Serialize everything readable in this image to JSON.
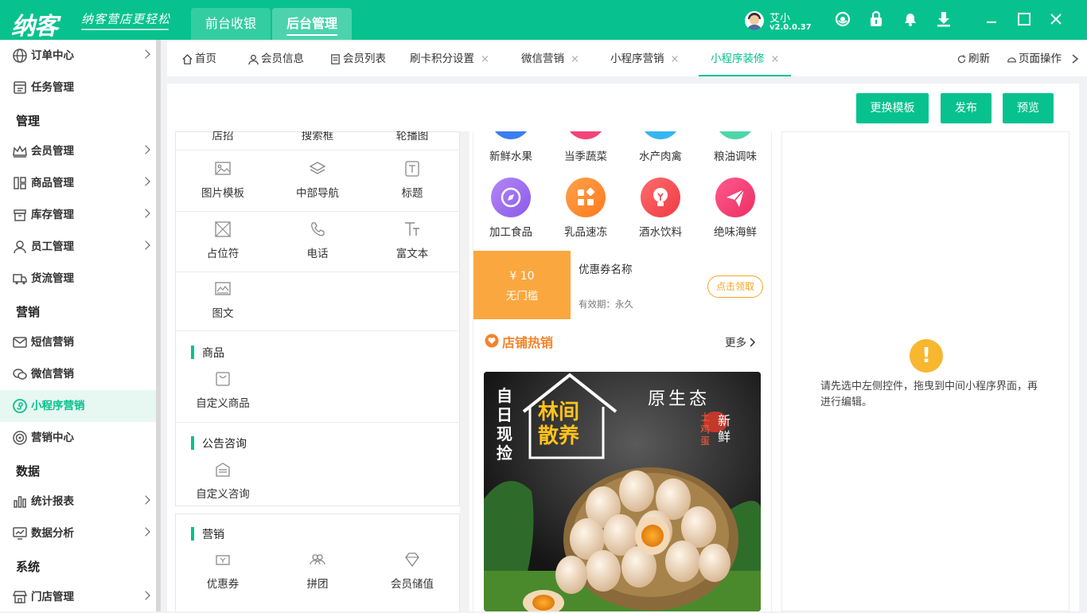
{
  "topbar": {
    "logo": "纳客",
    "slogan": "纳客营店更轻松",
    "nav": [
      "前台收银",
      "后台管理"
    ],
    "user_name": "艾小",
    "version": "v2.0.0.37"
  },
  "sidebar": {
    "items": [
      {
        "label": "订单中心",
        "arrow": true
      },
      {
        "label": "任务管理",
        "arrow": false
      }
    ],
    "section_manage": "管理",
    "manage_items": [
      {
        "label": "会员管理"
      },
      {
        "label": "商品管理"
      },
      {
        "label": "库存管理"
      },
      {
        "label": "员工管理"
      },
      {
        "label": "货流管理"
      }
    ],
    "section_marketing": "营销",
    "marketing_items": [
      {
        "label": "短信营销"
      },
      {
        "label": "微信营销"
      },
      {
        "label": "小程序营销"
      },
      {
        "label": "营销中心"
      }
    ],
    "section_data": "数据",
    "data_items": [
      {
        "label": "统计报表"
      },
      {
        "label": "数据分析"
      }
    ],
    "section_system": "系统",
    "system_items": [
      {
        "label": "门店管理"
      }
    ]
  },
  "tabs": [
    {
      "label": "首页"
    },
    {
      "label": "会员信息"
    },
    {
      "label": "会员列表"
    },
    {
      "label": "刷卡积分设置"
    },
    {
      "label": "微信营销"
    },
    {
      "label": "小程序营销"
    },
    {
      "label": "小程序装修"
    }
  ],
  "tab_close": "×",
  "tab_actions": {
    "refresh": "刷新",
    "page_ops": "页面操作"
  },
  "toolbar": {
    "change_template": "更换模板",
    "publish": "发布",
    "preview": "预览"
  },
  "widgets": {
    "top_partial": [
      "店招",
      "搜索框",
      "轮播图"
    ],
    "row1": [
      "图片模板",
      "中部导航",
      "标题"
    ],
    "row2": [
      "占位符",
      "电话",
      "富文本"
    ],
    "row3": [
      "图文"
    ],
    "cat_goods": "商品",
    "goods": [
      "自定义商品"
    ],
    "cat_news": "公告咨询",
    "news": [
      "自定义咨询"
    ],
    "cat_marketing": "营销",
    "marketing": [
      "优惠券",
      "拼团",
      "会员储值"
    ]
  },
  "phone": {
    "nav_row1": [
      "新鲜水果",
      "当季蔬菜",
      "水产肉禽",
      "粮油调味"
    ],
    "nav_row2": [
      "加工食品",
      "乳品速冻",
      "酒水饮料",
      "绝味海鲜"
    ],
    "colors": {
      "purple": "#9b6cf0",
      "orange": "#ff8a2b",
      "red": "#f4525b",
      "pink": "#f2447a"
    },
    "coupon": {
      "amount": "¥ 10",
      "condition": "无门槛",
      "name": "优惠券名称",
      "validity": "有效期：永久",
      "claim": "点击领取"
    },
    "hot": {
      "title": "店铺热销",
      "more": "更多"
    },
    "banner": {
      "text1": "自日现捡",
      "text2": "林间散养",
      "text3": "原生态",
      "text4": "土鸡蛋",
      "text5": "新鲜"
    }
  },
  "right_panel": {
    "warn": "!",
    "hint": "请先选中左侧控件，拖曳到中间小程序界面，再进行编辑。"
  },
  "accent": "#07c28e"
}
